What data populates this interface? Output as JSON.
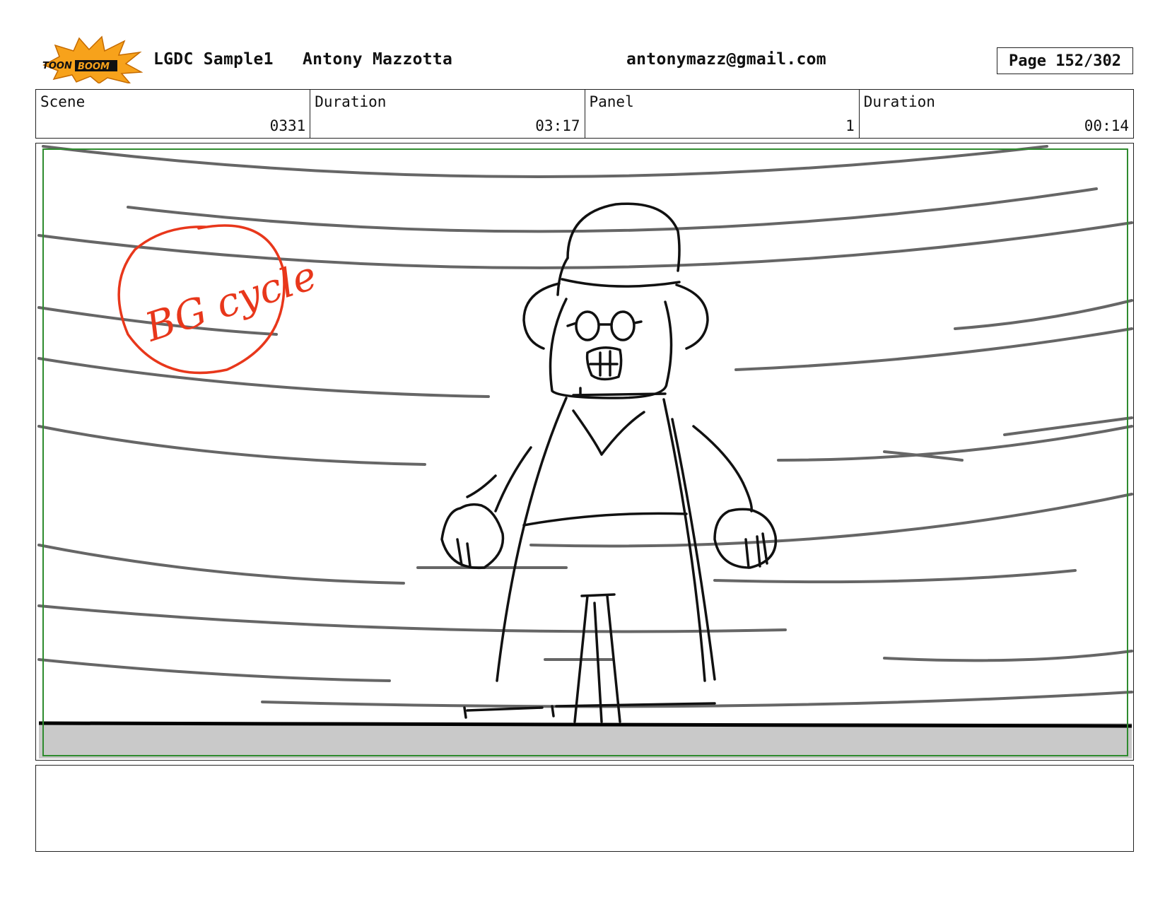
{
  "header": {
    "project": "LGDC Sample1",
    "author": "Antony Mazzotta",
    "email": "antonymazz@gmail.com",
    "page": "Page 152/302"
  },
  "info": {
    "scene_label": "Scene",
    "scene_value": "0331",
    "scene_duration_label": "Duration",
    "scene_duration_value": "03:17",
    "panel_label": "Panel",
    "panel_value": "1",
    "panel_duration_label": "Duration",
    "panel_duration_value": "00:14"
  },
  "panel": {
    "annotation": "BG cycle",
    "annotation_color": "#e8371b",
    "safe_frame_color": "#2e8b2e"
  },
  "logo": {
    "text": "TOONBOOM",
    "color": "#f7a21b"
  },
  "notes": {
    "text": ""
  }
}
